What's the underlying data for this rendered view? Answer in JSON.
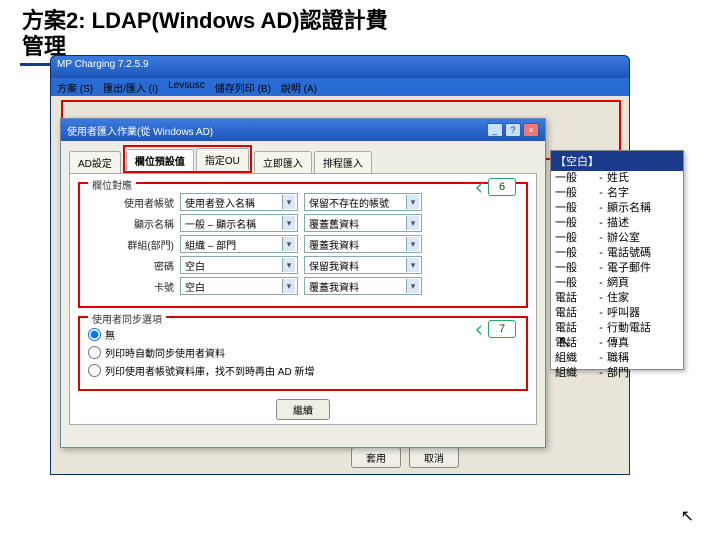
{
  "slide": {
    "title": "方案2: LDAP(Windows AD)認證計費管理"
  },
  "backWindow": {
    "title": "MP Charging 7.2.5.9",
    "menus": [
      "方案 (S)",
      "匯出/匯入 (I)",
      "Levsusc",
      "儲存列印 (B)",
      "說明 (A)"
    ],
    "buttons": {
      "apply": "套用",
      "cancel": "取消"
    }
  },
  "dialog": {
    "title": "使用者匯入作業(從 Windows AD)",
    "tabs": [
      "AD設定",
      "欄位預設值",
      "指定OU",
      "立即匯入",
      "排程匯入"
    ],
    "activeTab": 1,
    "group1": {
      "legend": "欄位對應",
      "rows": [
        {
          "label": "使用者帳號",
          "left": "使用者登入名稱",
          "right": "保留不存在的帳號"
        },
        {
          "label": "顯示名稱",
          "left": "一般 – 顯示名稱",
          "right": "覆蓋舊資料"
        },
        {
          "label": "群組(部門)",
          "left": "組織 – 部門",
          "right": "覆蓋我資料"
        },
        {
          "label": "密碼",
          "left": "空白",
          "right": "保留我資料"
        },
        {
          "label": "卡號",
          "left": "空白",
          "right": "覆蓋我資料"
        }
      ]
    },
    "group2": {
      "legend": "使用者同步選項",
      "radios": [
        "無",
        "列印時自動同步使用者資料",
        "列印使用者帳號資料庫，找不到時再由 AD 新增"
      ]
    },
    "next": "繼續"
  },
  "callouts": {
    "b6": "6",
    "b7": "7"
  },
  "sidePanel": {
    "header": "【空白】",
    "items": [
      [
        "一般",
        "姓氏"
      ],
      [
        "一般",
        "名字"
      ],
      [
        "一般",
        "顯示名稱"
      ],
      [
        "一般",
        "描述"
      ],
      [
        "一般",
        "辦公室"
      ],
      [
        "一般",
        "電話號碼"
      ],
      [
        "一般",
        "電子郵件"
      ],
      [
        "一般",
        "網頁"
      ],
      [
        "電話",
        "住家"
      ],
      [
        "電話",
        "呼叫器"
      ],
      [
        "電話",
        "行動電話"
      ],
      [
        "電話",
        "傳真"
      ],
      [
        "組織",
        "職稱"
      ],
      [
        "組織",
        "部門"
      ]
    ]
  }
}
